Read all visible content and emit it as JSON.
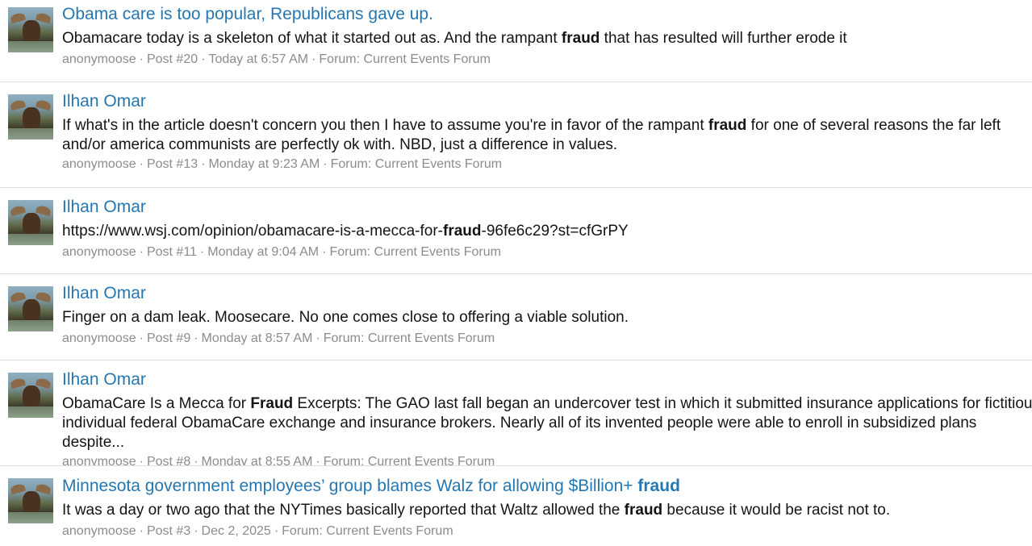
{
  "results": [
    {
      "title": "Obama care is too popular, Republicans gave up.",
      "snippet_before": "Obamacare today is a skeleton of what it started out as. And the rampant ",
      "snippet_bold": "fraud",
      "snippet_after": " that has resulted will further erode it",
      "author": "anonymoose",
      "post": "Post #20",
      "time": "Today at 6:57 AM",
      "forum": "Forum: Current Events Forum"
    },
    {
      "title": "Ilhan Omar",
      "snippet_before": "If what's in the article doesn't concern you then I have to assume you're in favor of the rampant ",
      "snippet_bold": "fraud",
      "snippet_after": " for one of several reasons the far left and/or america communists are perfectly ok with. NBD, just a difference in values.",
      "author": "anonymoose",
      "post": "Post #13",
      "time": "Monday at 9:23 AM",
      "forum": "Forum: Current Events Forum"
    },
    {
      "title": "Ilhan Omar",
      "snippet_before": "https://www.wsj.com/opinion/obamacare-is-a-mecca-for-",
      "snippet_bold": "fraud",
      "snippet_after": "-96fe6c29?st=cfGrPY",
      "author": "anonymoose",
      "post": "Post #11",
      "time": "Monday at 9:04 AM",
      "forum": "Forum: Current Events Forum"
    },
    {
      "title": "Ilhan Omar",
      "snippet_before": "Finger on a dam leak. Moosecare. No one comes close to offering a viable solution.",
      "snippet_bold": "",
      "snippet_after": "",
      "author": "anonymoose",
      "post": "Post #9",
      "time": "Monday at 8:57 AM",
      "forum": "Forum: Current Events Forum"
    },
    {
      "title": "Ilhan Omar",
      "snippet_before": "ObamaCare Is a Mecca for ",
      "snippet_bold": "Fraud",
      "snippet_after": " Excerpts: The GAO last fall began an undercover test in which it submitted insurance applications for fictitious individual federal ObamaCare exchange and insurance brokers. Nearly all of its invented people were able to enroll in subsidized plans despite...",
      "author": "anonymoose",
      "post": "Post #8",
      "time": "Monday at 8:55 AM",
      "forum": "Forum: Current Events Forum"
    },
    {
      "title_before": "Minnesota government employees’ group blames Walz for allowing $Billion+ ",
      "title_bold": "fraud",
      "snippet_before": "It was a day or two ago that the NYTimes basically reported that Waltz allowed the ",
      "snippet_bold": "fraud",
      "snippet_after": " because it would be racist not to.",
      "author": "anonymoose",
      "post": "Post #3",
      "time": "Dec 2, 2025",
      "forum": "Forum: Current Events Forum"
    }
  ],
  "separator": "·",
  "colors": {
    "link": "#2577b1",
    "meta": "#8c8c8c",
    "divider": "#dfdfdf"
  }
}
